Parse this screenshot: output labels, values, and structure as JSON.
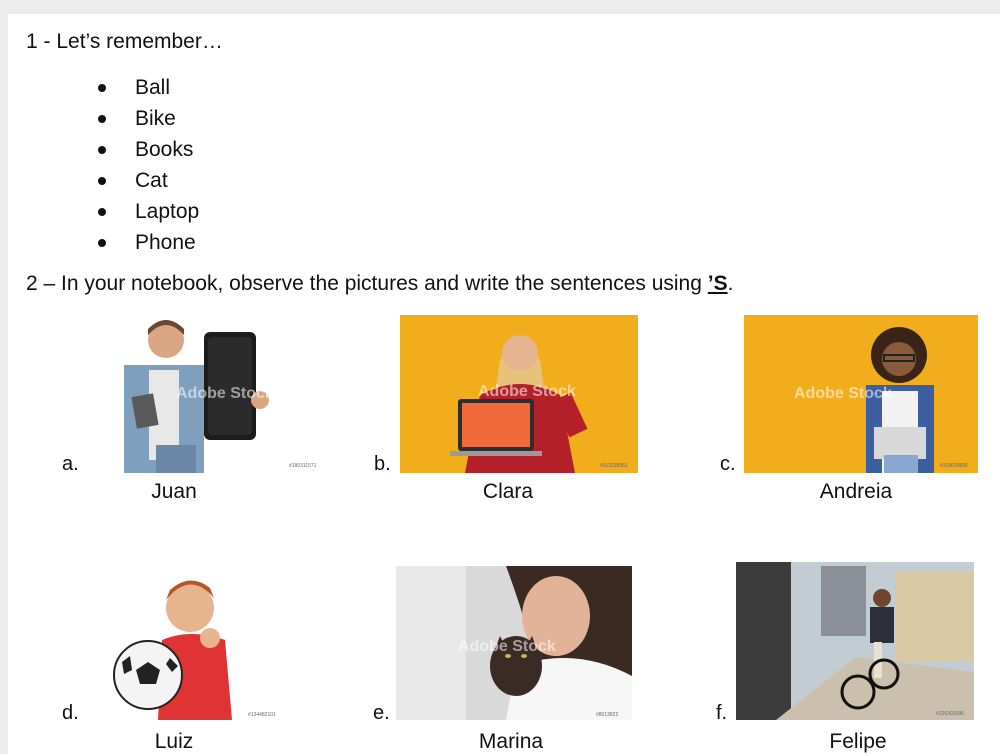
{
  "question1": {
    "text": "1 - Let’s remember…"
  },
  "vocabulary": [
    "Ball",
    "Bike",
    "Books",
    "Cat",
    "Laptop",
    "Phone"
  ],
  "question2": {
    "text": "2 – In your notebook, observe the pictures and write the sentences using ",
    "highlight": "’S",
    "end": "."
  },
  "pictures": [
    {
      "letter": "a.",
      "name": "Juan",
      "stock_id": "#180311571",
      "watermark": "Adobe Stock"
    },
    {
      "letter": "b.",
      "name": "Clara",
      "stock_id": "#313328951",
      "watermark": "Adobe Stock"
    },
    {
      "letter": "c.",
      "name": "Andreia",
      "stock_id": "#318639606",
      "watermark": "Adobe Stock"
    },
    {
      "letter": "d.",
      "name": "Luiz",
      "stock_id": "#134482101",
      "watermark": ""
    },
    {
      "letter": "e.",
      "name": "Marina",
      "stock_id": "#8013822",
      "watermark": "Adobe Stock"
    },
    {
      "letter": "f.",
      "name": "Felipe",
      "stock_id": "#226301096",
      "watermark": ""
    }
  ],
  "colors": {
    "yellow_bg": "#f2ad1c",
    "text": "#111111"
  }
}
